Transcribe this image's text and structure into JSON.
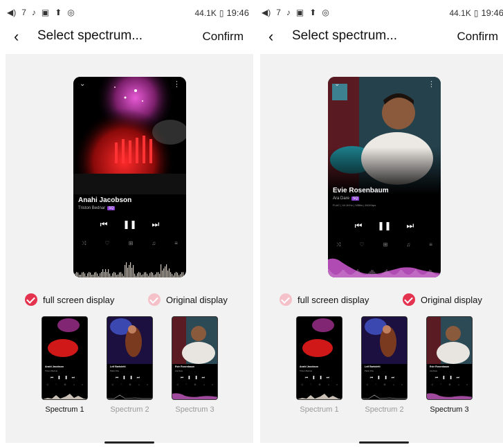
{
  "status_bar": {
    "left_text": "◀⁾ 7",
    "speed": "44.1K",
    "time": "19:46"
  },
  "header": {
    "back_icon": "chevron-left-icon",
    "title": "Select spectrum...",
    "confirm_label": "Confirm"
  },
  "colors": {
    "accent": "#e4334f",
    "accent_light": "#f5c1c9",
    "panel_bg": "#f2f2f2"
  },
  "panels": [
    {
      "preview": {
        "song": "Anahi Jacobson",
        "artist": "Triston Bednar",
        "tag": "SQ",
        "meta": ""
      },
      "options": [
        {
          "label": "full screen display",
          "checked": true
        },
        {
          "label": "Original display",
          "checked": false
        }
      ],
      "spectrums": [
        {
          "label": "Spectrum 1",
          "selected": true,
          "song": "Anahi Jacobson",
          "artist": "Triston Bednar"
        },
        {
          "label": "Spectrum 2",
          "selected": false,
          "song": "Leif Bartoletti",
          "artist": "Pablo Dhe"
        },
        {
          "label": "Spectrum 3",
          "selected": false,
          "song": "Evie Rosenbaum",
          "artist": "Ara Dare"
        }
      ]
    },
    {
      "preview": {
        "song": "Evie Rosenbaum",
        "artist": "Ara Dare",
        "tag": "SQ",
        "meta": "FLAC | 44.1KHz | 16Bits | 841Kbps"
      },
      "options": [
        {
          "label": "full screen display",
          "checked": false
        },
        {
          "label": "Original display",
          "checked": true
        }
      ],
      "spectrums": [
        {
          "label": "Spectrum 1",
          "selected": false,
          "song": "Anahi Jacobson",
          "artist": "Triston Bednar"
        },
        {
          "label": "Spectrum 2",
          "selected": false,
          "song": "Leif Bartoletti",
          "artist": "Pablo Dhe"
        },
        {
          "label": "Spectrum 3",
          "selected": true,
          "song": "Evie Rosenbaum",
          "artist": "Ara Dare"
        }
      ]
    }
  ]
}
